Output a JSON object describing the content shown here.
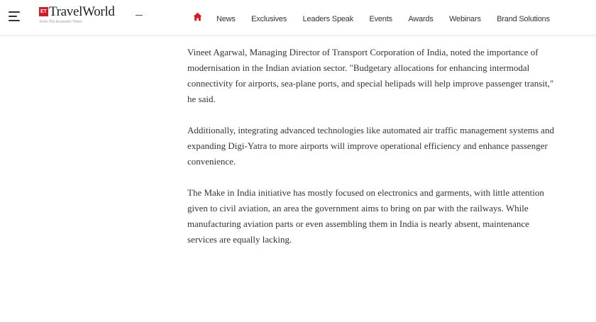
{
  "header": {
    "logo": {
      "badge": "ET",
      "name": "TravelWorld",
      "sub": "From The Economic Times"
    },
    "home_icon": "home-icon",
    "nav": [
      "News",
      "Exclusives",
      "Leaders Speak",
      "Events",
      "Awards",
      "Webinars",
      "Brand Solutions"
    ]
  },
  "article": {
    "paragraphs": [
      "Vineet Agarwal, Managing Director of Transport Corporation of India, noted the importance of modernisation in the Indian aviation sector. \"Budgetary allocations for enhancing intermodal connectivity for airports, sea-plane ports, and special helipads will help improve passenger transit,\" he said.",
      "Additionally, integrating advanced technologies like automated air traffic management systems and expanding Digi-Yatra to more airports will improve operational efficiency and enhance passenger convenience.",
      "The Make in India initiative has mostly focused on electronics and garments, with little attention given to civil aviation, an area the government aims to bring on par with the railways. While manufacturing aviation parts or even assembling them in India is nearly absent, maintenance services are equally lacking."
    ]
  },
  "colors": {
    "brand_red": "#d71920",
    "text": "#333333"
  }
}
